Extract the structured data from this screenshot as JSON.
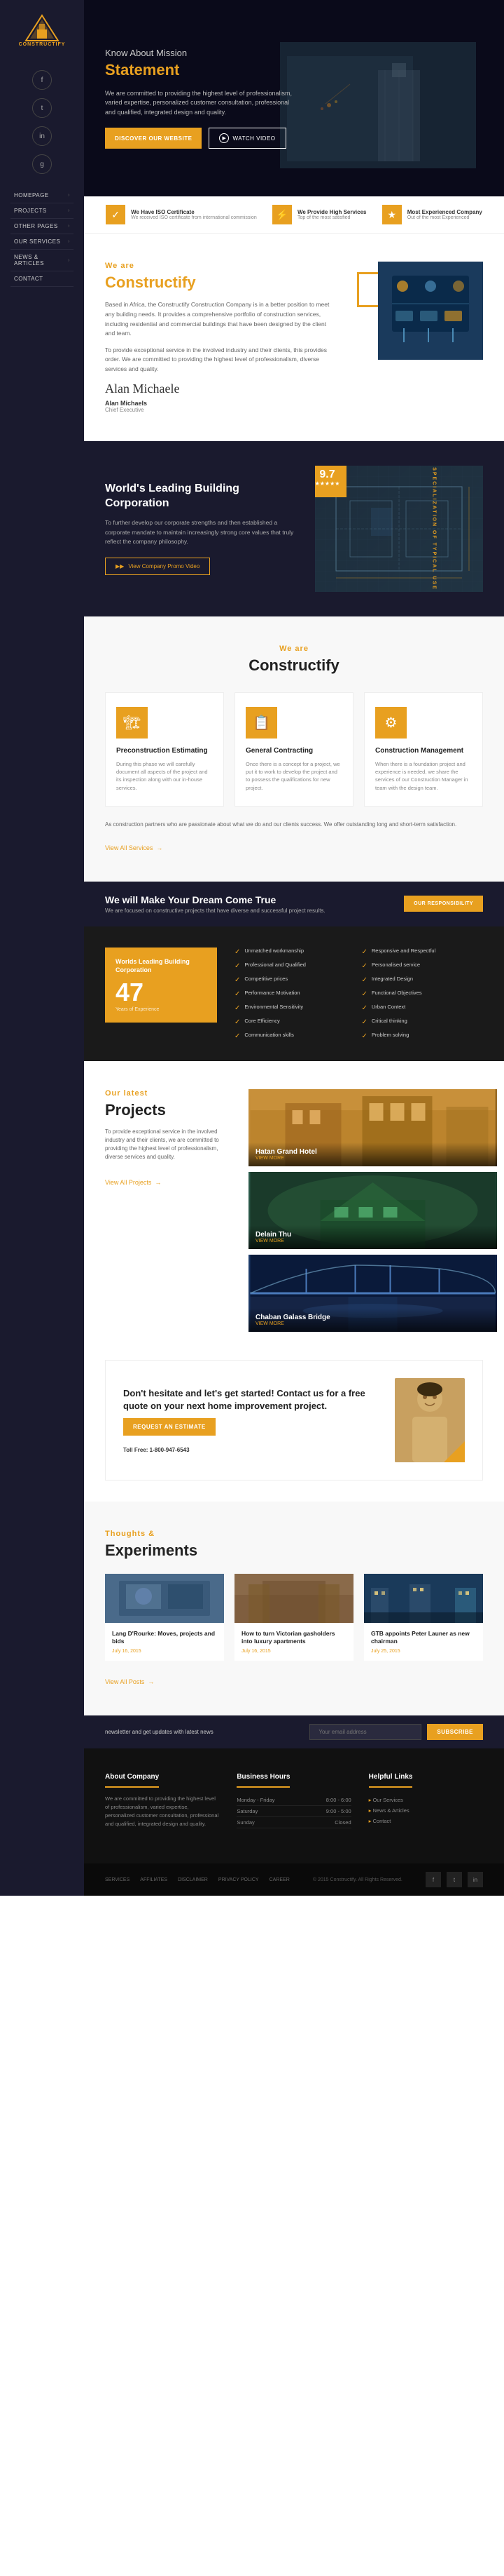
{
  "brand": {
    "name": "CONSTRUCTIFY",
    "logo_emoji": "🏗"
  },
  "nav": {
    "social_icons": [
      "f",
      "t",
      "in",
      "g+"
    ],
    "menu_items": [
      {
        "label": "HOMEPAGE",
        "has_arrow": true
      },
      {
        "label": "PROJECTS",
        "has_arrow": true
      },
      {
        "label": "OTHER PAGES",
        "has_arrow": true
      },
      {
        "label": "OUR SERVICES",
        "has_arrow": true
      },
      {
        "label": "NEWS & ARTICLES",
        "has_arrow": true
      },
      {
        "label": "CONTACT",
        "has_arrow": false
      }
    ]
  },
  "hero": {
    "subtitle": "Know About Mission",
    "title": "Statement",
    "description": "We are committed to providing the highest level of professionalism, varied expertise, personalized customer consultation, professional and qualified, integrated design and quality.",
    "btn_primary": "DISCOVER OUR WEBSITE",
    "btn_secondary": "WATCH VIDEO"
  },
  "stats": [
    {
      "icon": "✓",
      "label": "We Have ISO Certificate",
      "desc": "We received ISO certificate from international commission"
    },
    {
      "icon": "⚡",
      "label": "We Provide High Services",
      "desc": "Top of the most satisfied"
    },
    {
      "icon": "★",
      "label": "Most Experienced Company",
      "desc": "Out of the most Experienced"
    }
  ],
  "about": {
    "subtitle": "We are",
    "title": "Constructify",
    "desc1": "Based in Africa, the Constructify Construction Company is in a better position to meet any building needs. It provides a comprehensive portfolio of construction services, including residential and commercial buildings that have been designed by the client and team.",
    "desc2": "To provide exceptional service in the involved industry and their clients, this provides order. We are committed to providing the highest level of professionalism, diverse services and quality.",
    "signature": "Alan Michaels",
    "sig_name": "Alan Michaels",
    "sig_title": "Chief Executive"
  },
  "corporate": {
    "title": "World's Leading Building Corporation",
    "desc": "To further develop our corporate strengths and then established a corporate mandate to maintain increasingly strong core values that truly reflect the company philosophy.",
    "btn_label": "View Company Promo Video",
    "rating": "9.7",
    "rating_stars": "★★★★★",
    "side_label": "SPECIALIZATION OF TYPICAL USE"
  },
  "services": {
    "subtitle": "We are",
    "title": "Constructify",
    "cards": [
      {
        "icon": "🏗",
        "title": "Preconstruction Estimating",
        "desc": "During this phase we will carefully document all aspects of the project and its inspection along with our in-house services."
      },
      {
        "icon": "📋",
        "title": "General Contracting",
        "desc": "Once there is a concept for a project, we put it to work to develop the project and to possess the qualifications for new project."
      },
      {
        "icon": "⚙",
        "title": "Construction Management",
        "desc": "When there is a foundation project and experience is needed, we share the services of our Construction Manager in team with the design team."
      }
    ],
    "bottom_text": "As construction partners who are passionate about what we do and our clients success. We offer outstanding long and short-term satisfaction.",
    "view_all": "View All Services"
  },
  "dream": {
    "title": "We will Make Your Dream Come True",
    "subtitle": "We are focused on constructive projects that have diverse and successful project results.",
    "btn_label": "OUR RESPONSIBILITY"
  },
  "whyus": {
    "card_title": "Worlds Leading Building Corporation",
    "number": "47",
    "number_label": "Years of Experience",
    "items": [
      "Unmatched workmanship",
      "Professional and Qualified",
      "Competitive prices",
      "Performance Motivation",
      "Environmental Sensitivity",
      "Core Efficiency",
      "Communication skills",
      "Responsive and Respectful",
      "Personalised service",
      "Integrated Design",
      "Functional Objectives",
      "Urban Context",
      "Critical thinking",
      "Problem solving"
    ]
  },
  "projects": {
    "subtitle": "Our latest",
    "title": "Projects",
    "intro": "To provide exceptional service in the involved industry and their clients, we are committed to providing the highest level of professionalism, diverse services and quality.",
    "view_all": "View All Projects",
    "cards": [
      {
        "name": "Hatan Grand Hotel",
        "link": "VIEW MORE",
        "color": "#c8903a"
      },
      {
        "name": "Delain Thu",
        "link": "VIEW MORE",
        "color": "#2a5a3a"
      },
      {
        "name": "Chaban Galass Bridge",
        "link": "VIEW MORE",
        "color": "#1a3a6a"
      }
    ]
  },
  "cta": {
    "title": "Don't hesitate and let's get started! Contact us for a free quote on your next home improvement project.",
    "btn_label": "REQUEST AN ESTIMATE",
    "phone_label": "Toll Free: 1-800-947-6543"
  },
  "blog": {
    "subtitle": "Thoughts &",
    "title": "Experiments",
    "posts": [
      {
        "title": "Lang D'Rourke: Moves, projects and bids",
        "date": "July 16, 2015"
      },
      {
        "title": "How to turn Victorian gasholders into luxury apartments",
        "date": "July 16, 2015"
      },
      {
        "title": "GTB appoints Peter Launer as new chairman",
        "date": "July 25, 2015"
      }
    ],
    "view_all": "View All Posts"
  },
  "newsletter": {
    "text": "newsletter and get updates with latest news",
    "placeholder": "Your email address",
    "btn_label": "SUBSCRIBE"
  },
  "footer": {
    "about": {
      "title": "About Company",
      "text": "We are committed to providing the highest level of professionalism, varied expertise, personalized customer consultation, professional and qualified, integrated design and quality."
    },
    "hours": {
      "title": "Business Hours",
      "items": [
        {
          "day": "Monday - Friday",
          "time": "8:00 - 6:00"
        },
        {
          "day": "Saturday",
          "time": "9:00 - 5:00"
        },
        {
          "day": "Sunday",
          "time": "Closed"
        }
      ]
    },
    "links": {
      "title": "Helpful Links",
      "items": [
        "Our Services",
        "News & Articles",
        "Contact"
      ]
    },
    "bottom": {
      "copyright": "© 2015 Constructify. All Rights Reserved.",
      "links": [
        "SERVICES",
        "AFFILIATES",
        "DISCLAIMER",
        "PRIVACY POLICY",
        "CAREER"
      ]
    }
  }
}
